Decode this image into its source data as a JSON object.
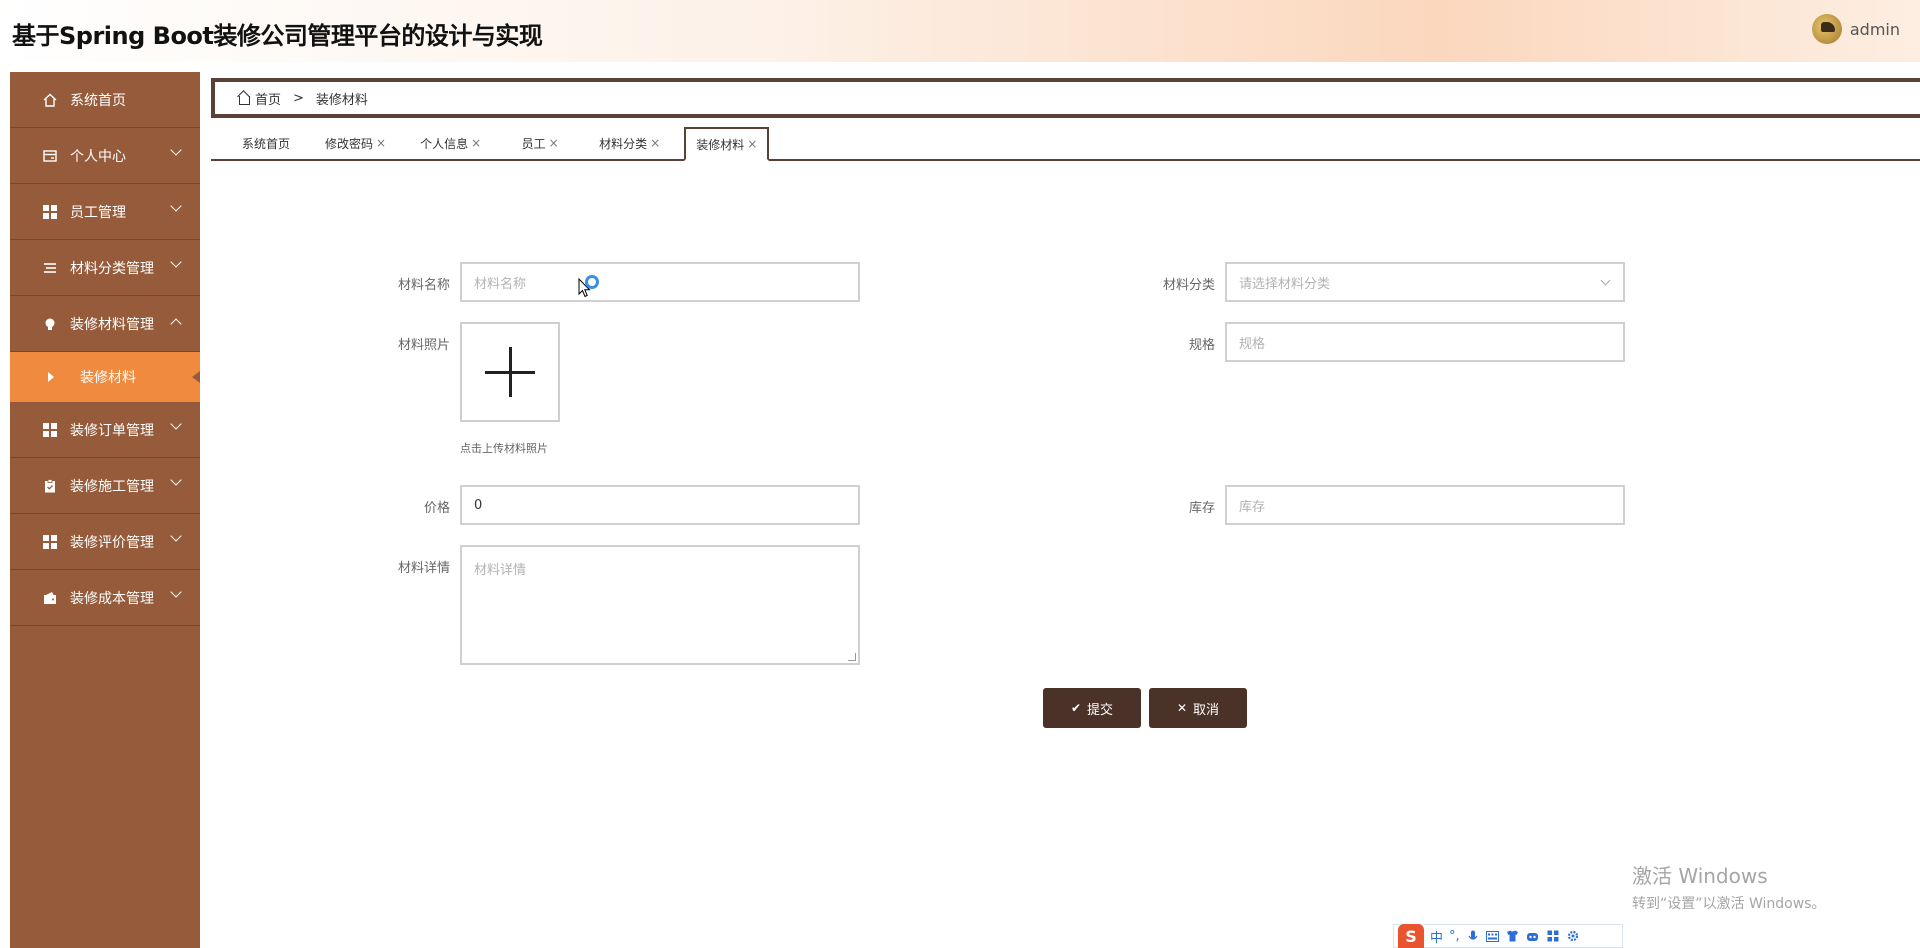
{
  "header": {
    "title": "基于Spring Boot装修公司管理平台的设计与实现",
    "username": "admin"
  },
  "sidebar": {
    "items": [
      {
        "label": "系统首页",
        "icon": "home-icon"
      },
      {
        "label": "个人中心",
        "icon": "card-icon"
      },
      {
        "label": "员工管理",
        "icon": "grid-icon"
      },
      {
        "label": "材料分类管理",
        "icon": "list-icon"
      },
      {
        "label": "装修材料管理",
        "icon": "bulb-icon"
      },
      {
        "label": "装修订单管理",
        "icon": "grid-icon"
      },
      {
        "label": "装修施工管理",
        "icon": "clipboard-icon"
      },
      {
        "label": "装修评价管理",
        "icon": "grid-icon"
      },
      {
        "label": "装修成本管理",
        "icon": "wallet-icon"
      }
    ],
    "active_sub": "装修材料"
  },
  "breadcrumb": {
    "home": "首页",
    "separator": ">",
    "current": "装修材料"
  },
  "tabs": [
    {
      "label": "系统首页",
      "closable": false
    },
    {
      "label": "修改密码",
      "closable": true
    },
    {
      "label": "个人信息",
      "closable": true
    },
    {
      "label": "员工",
      "closable": true
    },
    {
      "label": "材料分类",
      "closable": true
    },
    {
      "label": "装修材料",
      "closable": true,
      "active": true
    }
  ],
  "tab_close_glyph": "×",
  "form": {
    "name_label": "材料名称",
    "name_placeholder": "材料名称",
    "category_label": "材料分类",
    "category_placeholder": "请选择材料分类",
    "photo_label": "材料照片",
    "photo_hint": "点击上传材料照片",
    "spec_label": "规格",
    "spec_placeholder": "规格",
    "price_label": "价格",
    "price_value": "0",
    "stock_label": "库存",
    "stock_placeholder": "库存",
    "detail_label": "材料详情",
    "detail_placeholder": "材料详情"
  },
  "buttons": {
    "submit": "提交",
    "cancel": "取消"
  },
  "watermark": {
    "title": "激活 Windows",
    "subtitle": "转到“设置”以激活 Windows。"
  },
  "ime": {
    "logo": "S",
    "mode": "中",
    "punct": "°,"
  },
  "colors": {
    "sidebar_bg": "#965b3a",
    "active_sub_bg": "#f08a3e",
    "button_bg": "#4a3228",
    "border_dark": "#5a4035"
  }
}
